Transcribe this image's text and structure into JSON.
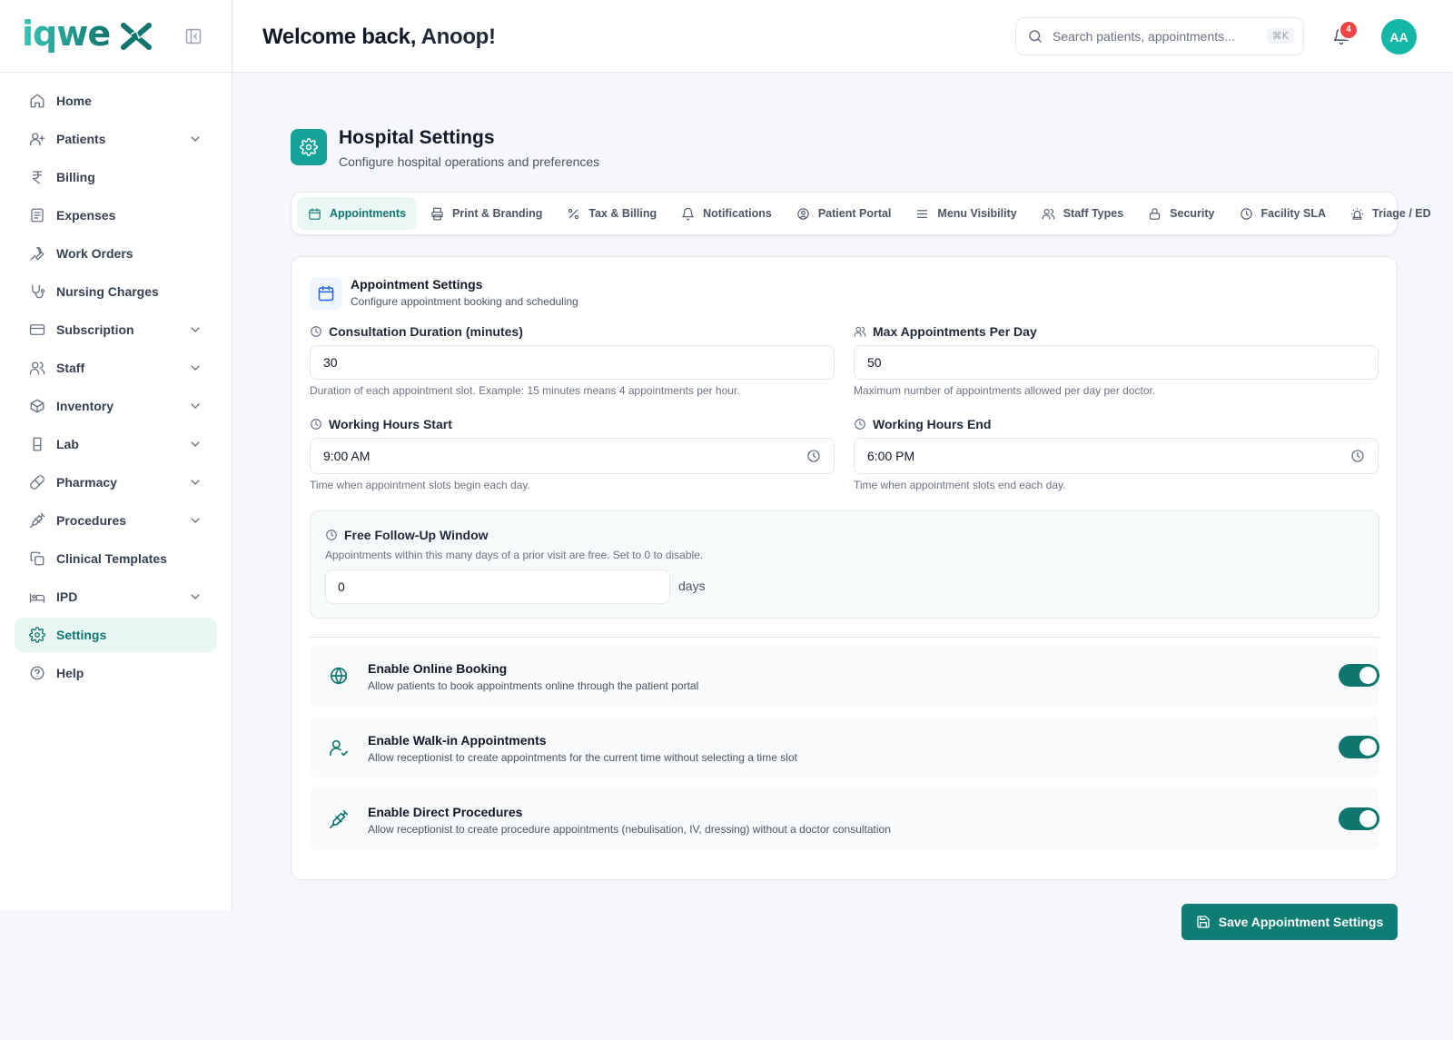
{
  "brand": {
    "logo_text": "iqwex",
    "accent": "#0f766e"
  },
  "sidebar": {
    "items": [
      {
        "label": "Home",
        "icon": "home-icon",
        "expandable": false
      },
      {
        "label": "Patients",
        "icon": "user-plus-icon",
        "expandable": true
      },
      {
        "label": "Billing",
        "icon": "rupee-icon",
        "expandable": false
      },
      {
        "label": "Expenses",
        "icon": "receipt-icon",
        "expandable": false
      },
      {
        "label": "Work Orders",
        "icon": "wrench-icon",
        "expandable": false
      },
      {
        "label": "Nursing Charges",
        "icon": "stethoscope-icon",
        "expandable": false
      },
      {
        "label": "Subscription",
        "icon": "credit-card-icon",
        "expandable": true
      },
      {
        "label": "Staff",
        "icon": "users-icon",
        "expandable": true
      },
      {
        "label": "Inventory",
        "icon": "package-icon",
        "expandable": true
      },
      {
        "label": "Lab",
        "icon": "flask-icon",
        "expandable": true
      },
      {
        "label": "Pharmacy",
        "icon": "pill-icon",
        "expandable": true
      },
      {
        "label": "Procedures",
        "icon": "syringe-icon",
        "expandable": true
      },
      {
        "label": "Clinical Templates",
        "icon": "copy-icon",
        "expandable": false
      },
      {
        "label": "IPD",
        "icon": "bed-icon",
        "expandable": true
      },
      {
        "label": "Settings",
        "icon": "gear-icon",
        "expandable": false,
        "active": true
      },
      {
        "label": "Help",
        "icon": "help-circle-icon",
        "expandable": false
      }
    ]
  },
  "header": {
    "greeting": "Welcome back,",
    "user_name": "Anoop!",
    "search_placeholder": "Search patients, appointments...",
    "search_shortcut": "⌘K",
    "notification_count": "4",
    "avatar_initials": "AA"
  },
  "page": {
    "title": "Hospital Settings",
    "subtitle": "Configure hospital operations and preferences"
  },
  "tabs": [
    {
      "label": "Appointments",
      "icon": "calendar-icon",
      "active": true
    },
    {
      "label": "Print & Branding",
      "icon": "printer-icon"
    },
    {
      "label": "Tax & Billing",
      "icon": "percent-icon"
    },
    {
      "label": "Notifications",
      "icon": "bell-icon"
    },
    {
      "label": "Patient Portal",
      "icon": "user-circle-icon"
    },
    {
      "label": "Menu Visibility",
      "icon": "menu-icon"
    },
    {
      "label": "Staff Types",
      "icon": "users-icon"
    },
    {
      "label": "Security",
      "icon": "lock-icon"
    },
    {
      "label": "Facility SLA",
      "icon": "clock-icon"
    },
    {
      "label": "Triage / ED",
      "icon": "siren-icon"
    }
  ],
  "appointment_settings": {
    "title": "Appointment Settings",
    "subtitle": "Configure appointment booking and scheduling",
    "consultation_duration": {
      "label": "Consultation Duration (minutes)",
      "value": "30",
      "help": "Duration of each appointment slot. Example: 15 minutes means 4 appointments per hour."
    },
    "max_appointments": {
      "label": "Max Appointments Per Day",
      "value": "50",
      "help": "Maximum number of appointments allowed per day per doctor."
    },
    "working_start": {
      "label": "Working Hours Start",
      "value": "9:00 AM",
      "help": "Time when appointment slots begin each day."
    },
    "working_end": {
      "label": "Working Hours End",
      "value": "6:00 PM",
      "help": "Time when appointment slots end each day."
    },
    "follow_up": {
      "label": "Free Follow-Up Window",
      "help": "Appointments within this many days of a prior visit are free. Set to 0 to disable.",
      "value": "0",
      "unit": "days"
    },
    "toggles": [
      {
        "title": "Enable Online Booking",
        "description": "Allow patients to book appointments online through the patient portal",
        "icon": "globe-icon",
        "enabled": true
      },
      {
        "title": "Enable Walk-in Appointments",
        "description": "Allow receptionist to create appointments for the current time without selecting a time slot",
        "icon": "user-check-icon",
        "enabled": true
      },
      {
        "title": "Enable Direct Procedures",
        "description": "Allow receptionist to create procedure appointments (nebulisation, IV, dressing) without a doctor consultation",
        "icon": "syringe-icon",
        "enabled": true
      }
    ],
    "save_label": "Save Appointment Settings"
  }
}
